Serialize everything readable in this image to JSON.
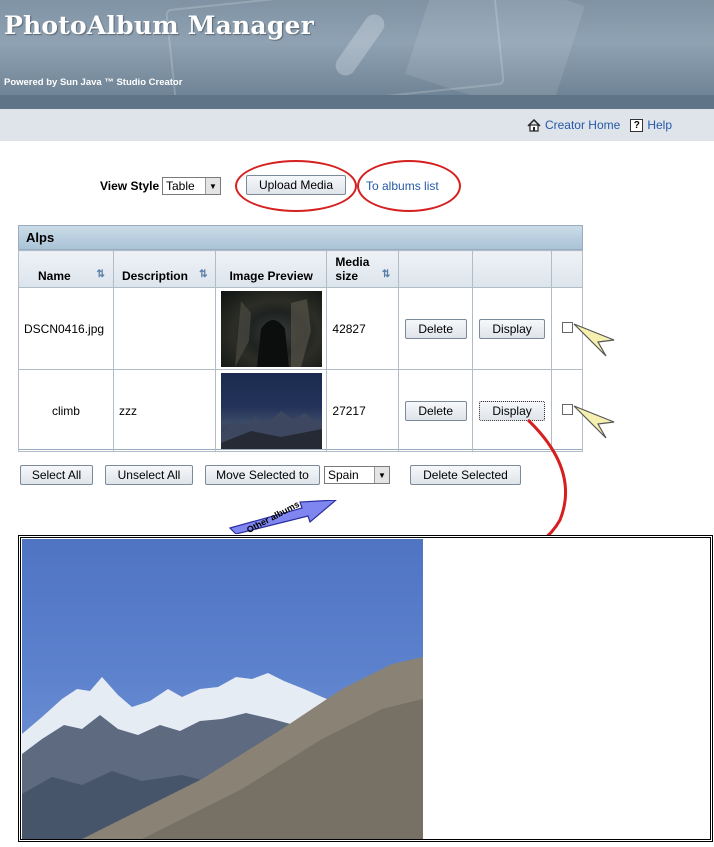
{
  "header": {
    "app_title": "PhotoAlbum Manager",
    "powered_by": "Powered by Sun Java ™ Studio Creator",
    "creator_home": "Creator Home",
    "help": "Help"
  },
  "toolbar": {
    "view_style_label": "View Style",
    "view_style_value": "Table",
    "upload_label": "Upload Media",
    "albums_link": "To albums list"
  },
  "table": {
    "title": "Alps",
    "columns": [
      "Name",
      "Description",
      "Image Preview",
      "Media size"
    ],
    "rows": [
      {
        "name": "DSCN0416.jpg",
        "description": "",
        "media_size": "42827",
        "delete_label": "Delete",
        "display_label": "Display",
        "checked": false
      },
      {
        "name": "climb",
        "description": "zzz",
        "media_size": "27217",
        "delete_label": "Delete",
        "display_label": "Display",
        "checked": false
      }
    ]
  },
  "actions": {
    "select_all": "Select All",
    "unselect_all": "Unselect All",
    "move_selected": "Move Selected to",
    "album_select_value": "Spain",
    "delete_selected": "Delete Selected"
  },
  "annotation": {
    "callout_text": "Other albums"
  },
  "colors": {
    "link": "#265aa7",
    "annotation_red": "#d62020",
    "panel_header": "#a9c3d6"
  }
}
